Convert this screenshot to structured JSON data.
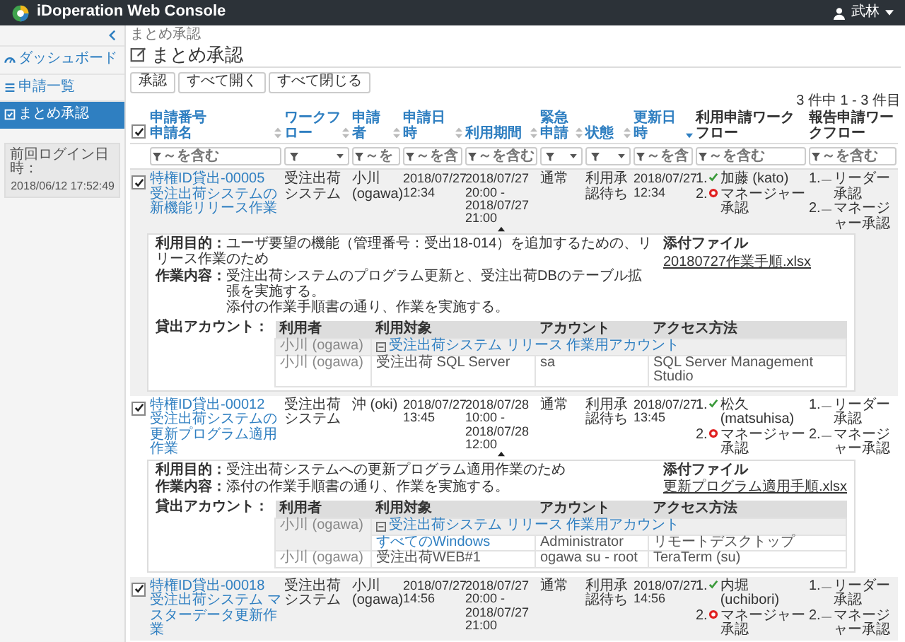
{
  "header": {
    "title": "iDoperation Web Console",
    "user": "武林"
  },
  "sidebar": {
    "items": [
      {
        "label": "ダッシュボード",
        "selected": false
      },
      {
        "label": "申請一覧",
        "selected": false
      },
      {
        "label": "まとめ承認",
        "selected": true
      }
    ],
    "last_login_label": "前回ログイン日時：",
    "last_login": "2018/06/12 17:52:49"
  },
  "breadcrumb": "まとめ承認",
  "page_title": "まとめ承認",
  "buttons": [
    "承認",
    "すべて開く",
    "すべて閉じる"
  ],
  "count": "3 件中 1 - 3 件目",
  "table": {
    "select_all": true,
    "columns": [
      {
        "lines": [
          "申請番号",
          "申請名"
        ],
        "sorted": false
      },
      {
        "lines": [
          "ワークフロー"
        ],
        "sorted": false
      },
      {
        "lines": [
          "申請者"
        ],
        "sorted": false
      },
      {
        "lines": [
          "申請日時"
        ],
        "sorted": false
      },
      {
        "lines": [
          "利用期間"
        ],
        "sorted": false
      },
      {
        "lines": [
          "緊急申請"
        ],
        "sorted": false
      },
      {
        "lines": [
          "状態"
        ],
        "sorted": false
      },
      {
        "lines": [
          "更新日時"
        ],
        "sorted": true
      },
      {
        "lines": [
          "利用申請ワークフロー"
        ]
      },
      {
        "lines": [
          "報告申請ワークフロー"
        ]
      }
    ],
    "filters": [
      {
        "kind": "text",
        "placeholder": "～を含む"
      },
      {
        "kind": "select"
      },
      {
        "kind": "text",
        "placeholder": "～を"
      },
      {
        "kind": "text",
        "placeholder": "～を含"
      },
      {
        "kind": "text",
        "placeholder": "～を含む"
      },
      {
        "kind": "select"
      },
      {
        "kind": "select"
      },
      {
        "kind": "text",
        "placeholder": "～を含"
      },
      {
        "kind": "text",
        "placeholder": "～を含む"
      },
      {
        "kind": "text",
        "placeholder": "～を含む"
      }
    ],
    "rows": [
      {
        "checked": true,
        "id": "特権ID貸出-00005",
        "name": "受注出荷システムの新機能リリース作業",
        "workflow": "受注出荷システム",
        "applicant": "小川 (ogawa)",
        "applied": "2018/07/27 12:34",
        "period": "2018/07/27 20:00 - 2018/07/27 21:00",
        "urgency": "通常",
        "status": "利用承認待ち",
        "updated": "2018/07/27 12:34",
        "usage_workflow": [
          {
            "no": "1.",
            "kind": "approved",
            "label": "加藤 (kato)"
          },
          {
            "no": "2.",
            "kind": "current",
            "label": "マネージャー承認"
          }
        ],
        "report_workflow": [
          {
            "no": "1.",
            "kind": "waiting",
            "label": "リーダー承認"
          },
          {
            "no": "2.",
            "kind": "waiting",
            "label": "マネージャー承認"
          }
        ],
        "expanded": true,
        "detail": {
          "purpose_label": "利用目的：",
          "purpose": "ユーザ要望の機能（管理番号：受出18-014）を追加するための、リリース作業のため",
          "content_label": "作業内容：",
          "content": [
            "受注出荷システムのプログラム更新と、受注出荷DBのテーブル拡張を実施する。",
            "添付の作業手順書の通り、作業を実施する。"
          ],
          "attachment_label": "添付ファイル",
          "attachment": "20180727作業手順.xlsx",
          "accounts_label": "貸出アカウント：",
          "account_columns": [
            "利用者",
            "利用対象",
            "アカウント",
            "アクセス方法"
          ],
          "accounts": [
            {
              "kind": "group",
              "user": "小川 (ogawa)",
              "target": "受注出荷システム リリース 作業用アカウント",
              "expanded": true
            },
            {
              "kind": "account",
              "user": "小川 (ogawa)",
              "target": "受注出荷 SQL Server",
              "account": "sa",
              "method": "SQL Server Management Studio"
            }
          ]
        }
      },
      {
        "checked": true,
        "id": "特権ID貸出-00012",
        "name": "受注出荷システムの更新プログラム適用作業",
        "workflow": "受注出荷システム",
        "applicant": "沖 (oki)",
        "applied": "2018/07/27 13:45",
        "period": "2018/07/28 10:00 - 2018/07/28 12:00",
        "urgency": "通常",
        "status": "利用承認待ち",
        "updated": "2018/07/27 13:45",
        "usage_workflow": [
          {
            "no": "1.",
            "kind": "approved",
            "label": "松久 (matsuhisa)"
          },
          {
            "no": "2.",
            "kind": "current",
            "label": "マネージャー承認"
          }
        ],
        "report_workflow": [
          {
            "no": "1.",
            "kind": "waiting",
            "label": "リーダー承認"
          },
          {
            "no": "2.",
            "kind": "waiting",
            "label": "マネージャー承認"
          }
        ],
        "expanded": true,
        "detail": {
          "purpose_label": "利用目的：",
          "purpose": "受注出荷システムへの更新プログラム適用作業のため",
          "content_label": "作業内容：",
          "content": [
            "添付の作業手順書の通り、作業を実施する。"
          ],
          "attachment_label": "添付ファイル",
          "attachment": "更新プログラム適用手順.xlsx",
          "accounts_label": "貸出アカウント：",
          "account_columns": [
            "利用者",
            "利用対象",
            "アカウント",
            "アクセス方法"
          ],
          "accounts": [
            {
              "kind": "group",
              "user": "小川 (ogawa)",
              "target": "受注出荷システム リリース 作業用アカウント",
              "expanded": true,
              "children": [
                {
                  "target": "すべてのWindows",
                  "account": "Administrator",
                  "method": "リモートデスクトップ"
                }
              ]
            },
            {
              "kind": "account",
              "user": "小川 (ogawa)",
              "target": "受注出荷WEB#1",
              "account": "ogawa su - root",
              "method": "TeraTerm (su)"
            }
          ]
        }
      },
      {
        "checked": true,
        "id": "特権ID貸出-00018",
        "name": "受注出荷システム マスターデータ更新作業",
        "workflow": "受注出荷システム",
        "applicant": "小川 (ogawa)",
        "applied": "2018/07/27 14:56",
        "period": "2018/07/27 20:00 - 2018/07/27 21:00",
        "urgency": "通常",
        "status": "利用承認待ち",
        "updated": "2018/07/27 14:56",
        "usage_workflow": [
          {
            "no": "1.",
            "kind": "approved",
            "label": "内堀 (uchibori)"
          },
          {
            "no": "2.",
            "kind": "current",
            "label": "マネージャー承認"
          }
        ],
        "report_workflow": [
          {
            "no": "1.",
            "kind": "waiting",
            "label": "リーダー承認"
          },
          {
            "no": "2.",
            "kind": "waiting",
            "label": "マネージャー承認"
          }
        ]
      }
    ]
  }
}
